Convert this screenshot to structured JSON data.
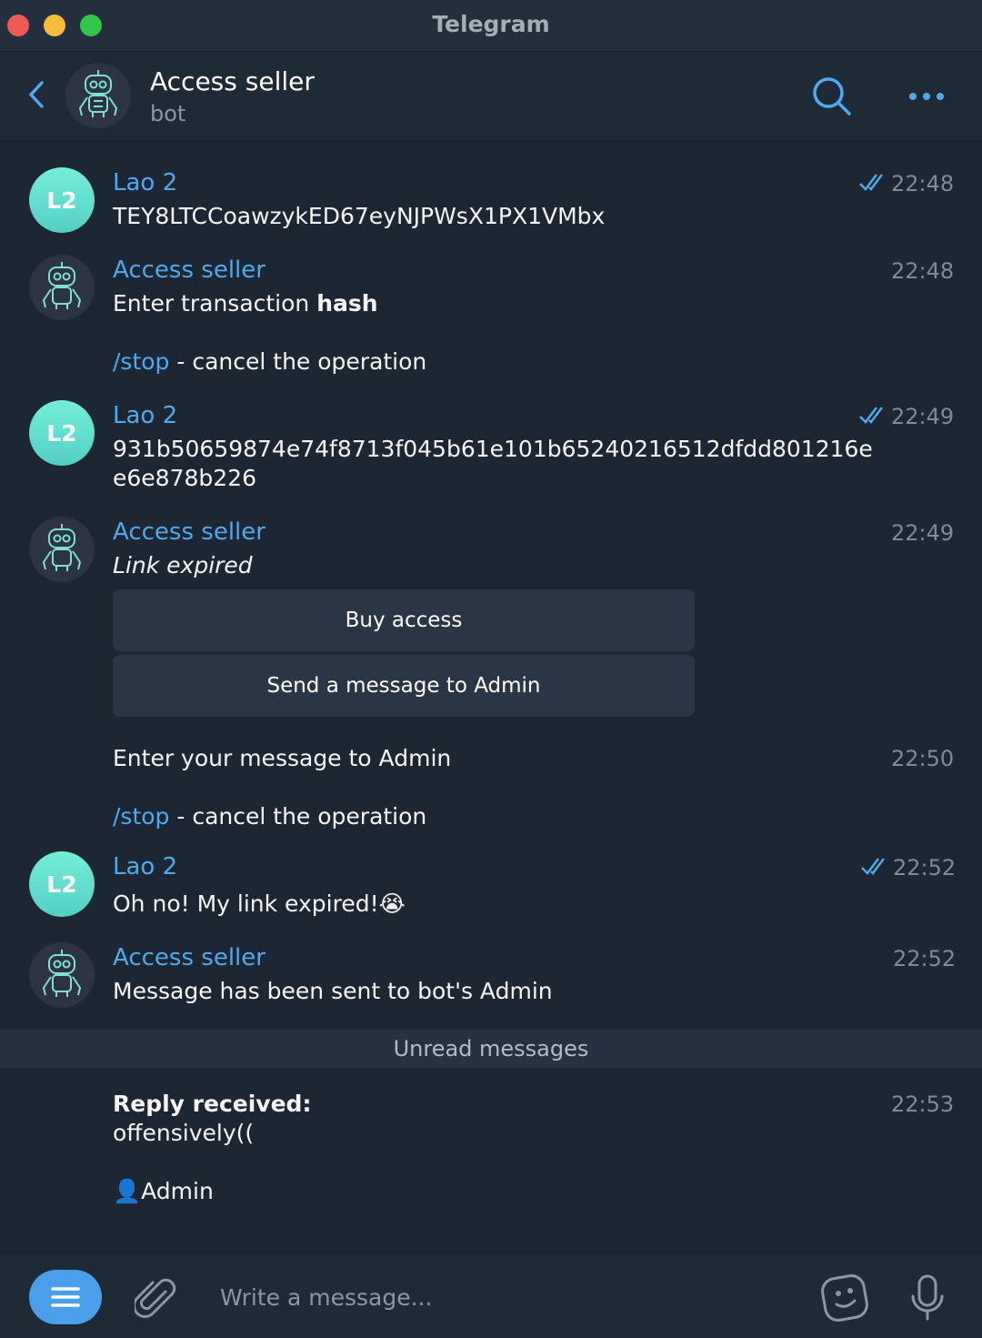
{
  "window": {
    "title": "Telegram"
  },
  "header": {
    "title": "Access seller",
    "subtitle": "bot"
  },
  "messages": [
    {
      "sender": "Lao 2",
      "avatar_initials": "L2",
      "time": "22:48",
      "text": "TEY8LTCCoawzykED67eyNJPWsX1PX1VMbx",
      "read": true
    },
    {
      "sender": "Access seller",
      "time": "22:48",
      "text_prefix": "Enter transaction ",
      "text_bold": "hash",
      "command": "/stop",
      "command_text": " - cancel the operation"
    },
    {
      "sender": "Lao 2",
      "avatar_initials": "L2",
      "time": "22:49",
      "text_line1": "931b50659874e74f8713f045b61e101b65240216512dfdd801216e",
      "text_line2": "e6e878b226",
      "read": true
    },
    {
      "sender": "Access seller",
      "time": "22:49",
      "text": "Link expired",
      "buttons": [
        "Buy access",
        "Send a message to Admin"
      ]
    },
    {
      "time": "22:50",
      "text": "Enter your message to Admin",
      "command": "/stop",
      "command_text": " - cancel the operation"
    },
    {
      "sender": "Lao 2",
      "avatar_initials": "L2",
      "time": "22:52",
      "text": "Oh no! My link expired!",
      "emoji": "😭",
      "read": true
    },
    {
      "sender": "Access seller",
      "time": "22:52",
      "text": "Message has been sent to bot's Admin"
    },
    {
      "time": "22:53",
      "title": "Reply received:",
      "text": "offensively((",
      "signature_emoji": "👤",
      "signature": "Admin"
    }
  ],
  "unread_label": "Unread messages",
  "compose": {
    "placeholder": "Write a message..."
  },
  "colors": {
    "accent": "#4fa9ee",
    "background": "#1c2733",
    "avatar_l2": "#60dccb"
  },
  "icons": [
    "back-icon",
    "search-icon",
    "more-icon",
    "menu-icon",
    "attach-icon",
    "sticker-icon",
    "microphone-icon",
    "double-check-icon",
    "robot-avatar-icon"
  ]
}
